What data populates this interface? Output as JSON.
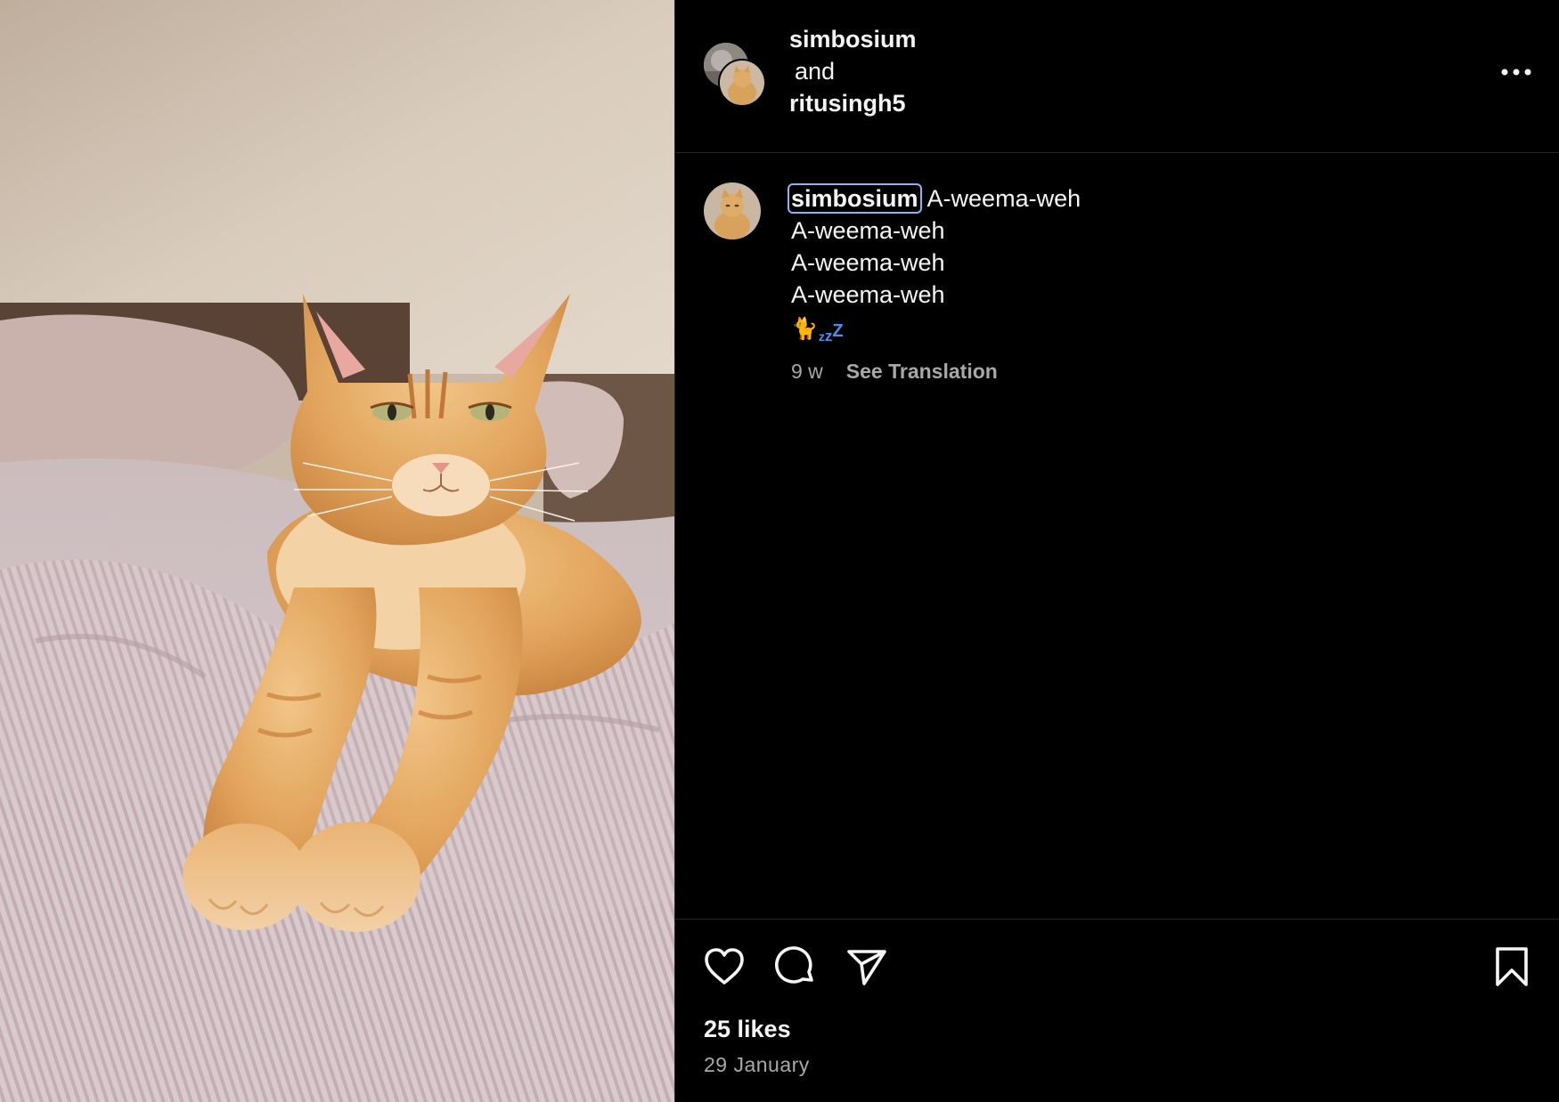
{
  "header": {
    "username_primary": "simbosium",
    "and_text": "and",
    "username_collab": "ritusingh5",
    "more_icon": "more-horizontal-icon"
  },
  "caption": {
    "username": "simbosium",
    "lines": [
      "A-weema-weh",
      "A-weema-weh",
      "A-weema-weh",
      "A-weema-weh"
    ],
    "emoji": "🐈",
    "zzz": "zzz",
    "zzz_color": "#4a8ff5",
    "age": "9 w",
    "translate_label": "See Translation"
  },
  "actions": {
    "like_icon": "heart-icon",
    "comment_icon": "comment-icon",
    "share_icon": "send-icon",
    "save_icon": "bookmark-icon",
    "likes": "25 likes",
    "date": "29 January"
  },
  "media": {
    "subject": "orange tabby cat lying on bed"
  }
}
